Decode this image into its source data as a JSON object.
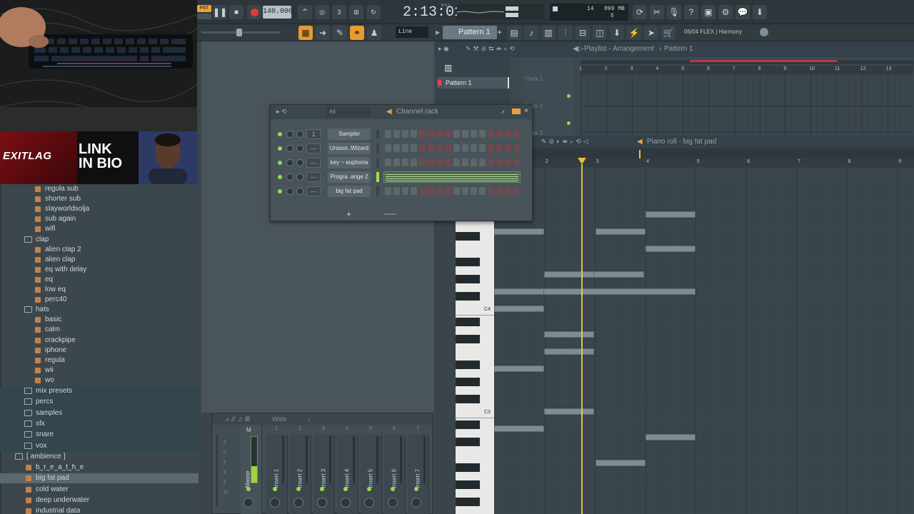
{
  "toolbar": {
    "pat_label": "PAT",
    "tempo": "140.000",
    "time": "2:13:01",
    "time_sub": "B:S:T",
    "cpu_voices": "14",
    "memory": "899 MB",
    "polyphony": "5",
    "snap_mode": "Line",
    "pattern_name": "Pattern 1",
    "news": "06/04  FLEX | Harmony"
  },
  "banner": {
    "brand": "EXITLAG",
    "cta_line1": "LINK",
    "cta_line2": "IN BIO"
  },
  "browser": {
    "items": [
      {
        "label": "regula sub",
        "type": "file",
        "indent": 3
      },
      {
        "label": "shorter sub",
        "type": "file",
        "indent": 3
      },
      {
        "label": "slayworldsolja",
        "type": "file",
        "indent": 3
      },
      {
        "label": "sub again",
        "type": "file",
        "indent": 3
      },
      {
        "label": "wifi",
        "type": "file",
        "indent": 3
      },
      {
        "label": "clap",
        "type": "folder",
        "indent": 2
      },
      {
        "label": "alien clap 2",
        "type": "file",
        "indent": 3
      },
      {
        "label": "alien clap",
        "type": "file",
        "indent": 3
      },
      {
        "label": "eq with delay",
        "type": "file",
        "indent": 3
      },
      {
        "label": "eq",
        "type": "file",
        "indent": 3
      },
      {
        "label": "low eq",
        "type": "file",
        "indent": 3
      },
      {
        "label": "perc40",
        "type": "file",
        "indent": 3
      },
      {
        "label": "hats",
        "type": "folder",
        "indent": 2
      },
      {
        "label": "basic",
        "type": "file",
        "indent": 3
      },
      {
        "label": "calm",
        "type": "file",
        "indent": 3
      },
      {
        "label": "crackpipe",
        "type": "file",
        "indent": 3
      },
      {
        "label": "iphone",
        "type": "file",
        "indent": 3
      },
      {
        "label": "regula",
        "type": "file",
        "indent": 3
      },
      {
        "label": "wii",
        "type": "file",
        "indent": 3
      },
      {
        "label": "wo",
        "type": "file",
        "indent": 3
      },
      {
        "label": "mix presets",
        "type": "folder",
        "indent": 2
      },
      {
        "label": "percs",
        "type": "folder",
        "indent": 2
      },
      {
        "label": "samples",
        "type": "folder",
        "indent": 2
      },
      {
        "label": "sfx",
        "type": "folder",
        "indent": 2
      },
      {
        "label": "snare",
        "type": "folder",
        "indent": 2
      },
      {
        "label": "vox",
        "type": "folder",
        "indent": 2
      },
      {
        "label": "[ ambience ]",
        "type": "folder",
        "indent": 1
      },
      {
        "label": "b_r_e_a_t_h_e",
        "type": "file",
        "indent": 2
      },
      {
        "label": "big fat pad",
        "type": "file",
        "indent": 2,
        "selected": true
      },
      {
        "label": "cold water",
        "type": "file",
        "indent": 2
      },
      {
        "label": "deep underwater",
        "type": "file",
        "indent": 2
      },
      {
        "label": "industrial data",
        "type": "file",
        "indent": 2
      }
    ]
  },
  "channel_rack": {
    "title": "Channel rack",
    "filter": "All",
    "swing_index": "1",
    "channels": [
      {
        "name": "Sampler",
        "mode": "steps"
      },
      {
        "name": "Unison..Wizard",
        "mode": "steps"
      },
      {
        "name": "key ~ euphoria",
        "mode": "steps"
      },
      {
        "name": "Progra..ange 2",
        "mode": "piano",
        "selected": true
      },
      {
        "name": "big fat pad",
        "mode": "steps"
      }
    ],
    "add_label": "+"
  },
  "mixer": {
    "preset": "Wide",
    "master_label": "Master",
    "master_marker": "M",
    "inserts": [
      "Insert 1",
      "Insert 2",
      "Insert 3",
      "Insert 4",
      "Insert 5",
      "Insert 6",
      "Insert 7"
    ],
    "insert_numbers": [
      "1",
      "2",
      "3",
      "4",
      "5",
      "6",
      "7"
    ],
    "scale": [
      "3",
      "0",
      "3",
      "6",
      "9",
      "15"
    ]
  },
  "playlist": {
    "title": "Playlist - Arrangement",
    "pattern": "Pattern 1",
    "pattern_item": "Pattern 1",
    "tracks": [
      "Track 1",
      "Track 2",
      "Track 3"
    ],
    "ruler": [
      "1",
      "2",
      "3",
      "4",
      "5",
      "6",
      "7",
      "8",
      "9",
      "10",
      "11",
      "12",
      "13"
    ]
  },
  "piano_roll": {
    "title": "Piano roll - big fat pad",
    "ruler": [
      "2",
      "3",
      "4",
      "5",
      "6",
      "7",
      "8",
      "9"
    ],
    "octave_labels": [
      "C4",
      "C3",
      "C2"
    ],
    "notes_count": 22
  }
}
